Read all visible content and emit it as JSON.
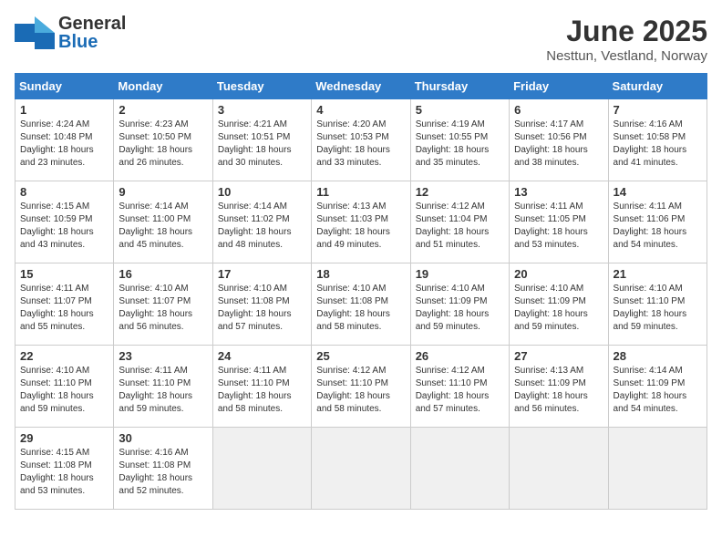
{
  "header": {
    "logo_general": "General",
    "logo_blue": "Blue",
    "month_title": "June 2025",
    "subtitle": "Nesttun, Vestland, Norway"
  },
  "days_of_week": [
    "Sunday",
    "Monday",
    "Tuesday",
    "Wednesday",
    "Thursday",
    "Friday",
    "Saturday"
  ],
  "weeks": [
    [
      {
        "day": "1",
        "rise": "4:24 AM",
        "set": "10:48 PM",
        "daylight": "18 hours and 23 minutes."
      },
      {
        "day": "2",
        "rise": "4:23 AM",
        "set": "10:50 PM",
        "daylight": "18 hours and 26 minutes."
      },
      {
        "day": "3",
        "rise": "4:21 AM",
        "set": "10:51 PM",
        "daylight": "18 hours and 30 minutes."
      },
      {
        "day": "4",
        "rise": "4:20 AM",
        "set": "10:53 PM",
        "daylight": "18 hours and 33 minutes."
      },
      {
        "day": "5",
        "rise": "4:19 AM",
        "set": "10:55 PM",
        "daylight": "18 hours and 35 minutes."
      },
      {
        "day": "6",
        "rise": "4:17 AM",
        "set": "10:56 PM",
        "daylight": "18 hours and 38 minutes."
      },
      {
        "day": "7",
        "rise": "4:16 AM",
        "set": "10:58 PM",
        "daylight": "18 hours and 41 minutes."
      }
    ],
    [
      {
        "day": "8",
        "rise": "4:15 AM",
        "set": "10:59 PM",
        "daylight": "18 hours and 43 minutes."
      },
      {
        "day": "9",
        "rise": "4:14 AM",
        "set": "11:00 PM",
        "daylight": "18 hours and 45 minutes."
      },
      {
        "day": "10",
        "rise": "4:14 AM",
        "set": "11:02 PM",
        "daylight": "18 hours and 48 minutes."
      },
      {
        "day": "11",
        "rise": "4:13 AM",
        "set": "11:03 PM",
        "daylight": "18 hours and 49 minutes."
      },
      {
        "day": "12",
        "rise": "4:12 AM",
        "set": "11:04 PM",
        "daylight": "18 hours and 51 minutes."
      },
      {
        "day": "13",
        "rise": "4:11 AM",
        "set": "11:05 PM",
        "daylight": "18 hours and 53 minutes."
      },
      {
        "day": "14",
        "rise": "4:11 AM",
        "set": "11:06 PM",
        "daylight": "18 hours and 54 minutes."
      }
    ],
    [
      {
        "day": "15",
        "rise": "4:11 AM",
        "set": "11:07 PM",
        "daylight": "18 hours and 55 minutes."
      },
      {
        "day": "16",
        "rise": "4:10 AM",
        "set": "11:07 PM",
        "daylight": "18 hours and 56 minutes."
      },
      {
        "day": "17",
        "rise": "4:10 AM",
        "set": "11:08 PM",
        "daylight": "18 hours and 57 minutes."
      },
      {
        "day": "18",
        "rise": "4:10 AM",
        "set": "11:08 PM",
        "daylight": "18 hours and 58 minutes."
      },
      {
        "day": "19",
        "rise": "4:10 AM",
        "set": "11:09 PM",
        "daylight": "18 hours and 59 minutes."
      },
      {
        "day": "20",
        "rise": "4:10 AM",
        "set": "11:09 PM",
        "daylight": "18 hours and 59 minutes."
      },
      {
        "day": "21",
        "rise": "4:10 AM",
        "set": "11:10 PM",
        "daylight": "18 hours and 59 minutes."
      }
    ],
    [
      {
        "day": "22",
        "rise": "4:10 AM",
        "set": "11:10 PM",
        "daylight": "18 hours and 59 minutes."
      },
      {
        "day": "23",
        "rise": "4:11 AM",
        "set": "11:10 PM",
        "daylight": "18 hours and 59 minutes."
      },
      {
        "day": "24",
        "rise": "4:11 AM",
        "set": "11:10 PM",
        "daylight": "18 hours and 58 minutes."
      },
      {
        "day": "25",
        "rise": "4:12 AM",
        "set": "11:10 PM",
        "daylight": "18 hours and 58 minutes."
      },
      {
        "day": "26",
        "rise": "4:12 AM",
        "set": "11:10 PM",
        "daylight": "18 hours and 57 minutes."
      },
      {
        "day": "27",
        "rise": "4:13 AM",
        "set": "11:09 PM",
        "daylight": "18 hours and 56 minutes."
      },
      {
        "day": "28",
        "rise": "4:14 AM",
        "set": "11:09 PM",
        "daylight": "18 hours and 54 minutes."
      }
    ],
    [
      {
        "day": "29",
        "rise": "4:15 AM",
        "set": "11:08 PM",
        "daylight": "18 hours and 53 minutes."
      },
      {
        "day": "30",
        "rise": "4:16 AM",
        "set": "11:08 PM",
        "daylight": "18 hours and 52 minutes."
      },
      null,
      null,
      null,
      null,
      null
    ]
  ]
}
